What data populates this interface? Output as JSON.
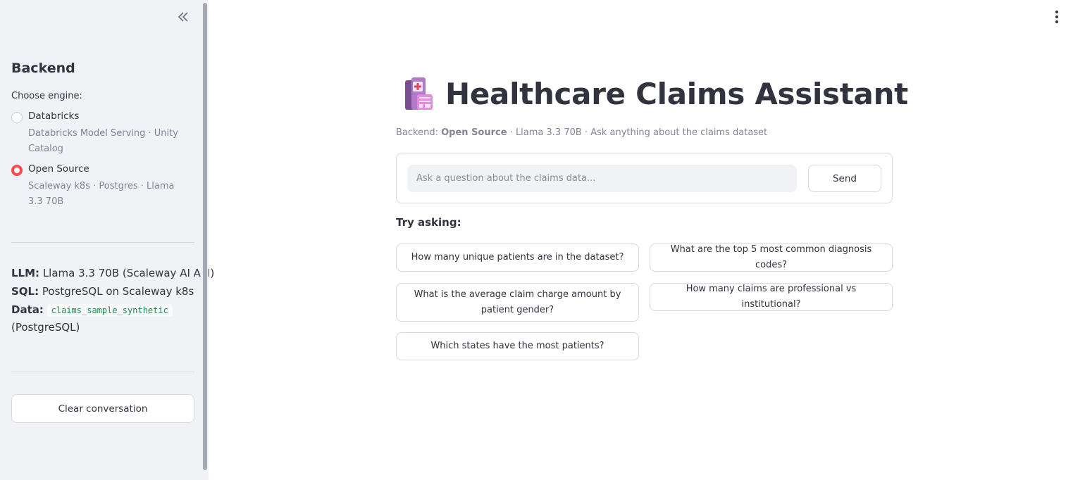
{
  "sidebar": {
    "heading": "Backend",
    "engine_label": "Choose engine:",
    "options": [
      {
        "title": "Databricks",
        "description": "Databricks Model Serving · Unity Catalog",
        "selected": false
      },
      {
        "title": "Open Source",
        "description": "Scaleway k8s · Postgres · Llama 3.3 70B",
        "selected": true
      }
    ],
    "info": {
      "llm_label": "LLM:",
      "llm_value": "Llama 3.3 70B (Scaleway AI API)",
      "sql_label": "SQL:",
      "sql_value": "PostgreSQL on Scaleway k8s",
      "data_label": "Data:",
      "data_code": "claims_sample_synthetic",
      "data_suffix": "(PostgreSQL)"
    },
    "clear_button": "Clear conversation"
  },
  "main": {
    "title": "Healthcare Claims Assistant",
    "caption_prefix": "Backend: ",
    "caption_backend": "Open Source",
    "caption_suffix": " · Llama 3.3 70B · Ask anything about the claims dataset",
    "input_placeholder": "Ask a question about the claims data...",
    "send_label": "Send",
    "try_heading": "Try asking:",
    "suggestions": [
      "How many unique patients are in the dataset?",
      "What are the top 5 most common diagnosis codes?",
      "What is the average claim charge amount by patient gender?",
      "How many claims are professional vs institutional?",
      "Which states have the most patients?"
    ]
  },
  "colors": {
    "accent": "#ff4b4b",
    "sidebar_bg": "#f0f2f6",
    "text": "#31333f",
    "muted": "#808495"
  },
  "icons": {
    "collapse": "double-chevron-left-icon",
    "menu": "kebab-menu-icon",
    "title": "hospital-icon"
  }
}
